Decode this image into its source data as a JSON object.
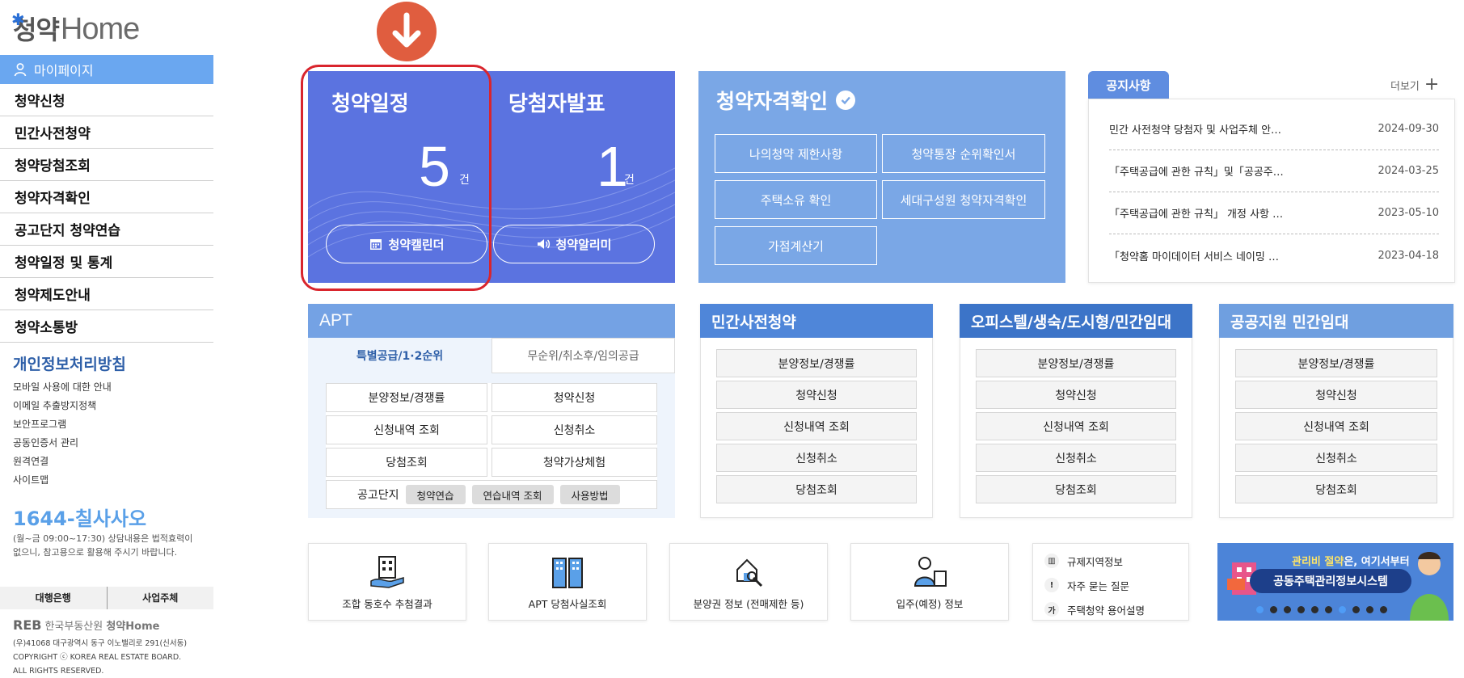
{
  "sidebar": {
    "logo_korean": "청약",
    "logo_english": "Home",
    "mypage_label": "마이페이지",
    "menu": [
      "청약신청",
      "민간사전청약",
      "청약당첨조회",
      "청약자격확인",
      "공고단지 청약연습",
      "청약일정 및 통계",
      "청약제도안내",
      "청약소통방"
    ],
    "policy_label": "개인정보처리방침",
    "sublinks": [
      "모바일 사용에 대한 안내",
      "이메일 추출방지정책",
      "보안프로그램",
      "공동인증서 관리",
      "원격연결",
      "사이트맵"
    ],
    "phone_prefix": "1644-",
    "phone_word": "칠사사오",
    "phone_note": "(월~금 09:00~17:30) 상담내용은 법적효력이 없으니, 참고용으로 활용해 주시기 바랍니다.",
    "bank_label": "대행은행",
    "business_label": "사업주체",
    "reb_mark": "REB",
    "reb_name": "한국부동산원",
    "reb_site": "청약Home",
    "address": "(우)41068 대구광역시 동구 이노밸리로 291(신서동)",
    "copyright": "COPYRIGHT ⓒ KOREA REAL ESTATE BOARD.",
    "rights": "ALL RIGHTS RESERVED."
  },
  "schedule": {
    "title": "청약일정",
    "count": "5",
    "unit": "건",
    "button": "청약캘린더"
  },
  "winners": {
    "title": "당첨자발표",
    "count": "1",
    "unit": "건",
    "button": "청약알리미"
  },
  "qualification": {
    "title": "청약자격확인",
    "buttons": [
      "나의청약 제한사항",
      "청약통장 순위확인서",
      "주택소유 확인",
      "세대구성원 청약자격확인",
      "가점계산기"
    ]
  },
  "notice": {
    "tab": "공지사항",
    "more": "더보기",
    "items": [
      {
        "title": "민간 사전청약 당첨자 및 사업주체 안…",
        "date": "2024-09-30"
      },
      {
        "title": "「주택공급에 관한 규칙」및「공공주…",
        "date": "2024-03-25"
      },
      {
        "title": "「주택공급에 관한 규칙」 개정 사항 …",
        "date": "2023-05-10"
      },
      {
        "title": "「청약홈 마이데이터 서비스 네이밍 …",
        "date": "2023-04-18"
      }
    ]
  },
  "apt": {
    "title": "APT",
    "tab_active": "특별공급/1·2순위",
    "tab_inactive": "무순위/취소후/임의공급",
    "buttons": [
      "분양정보/경쟁률",
      "청약신청",
      "신청내역 조회",
      "신청취소",
      "당첨조회",
      "청약가상체험"
    ],
    "gong_label": "공고단지",
    "gong_chips": [
      "청약연습",
      "연습내역 조회",
      "사용방법"
    ]
  },
  "categories": [
    {
      "title": "민간사전청약",
      "buttons": [
        "분양정보/경쟁률",
        "청약신청",
        "신청내역 조회",
        "신청취소",
        "당첨조회"
      ]
    },
    {
      "title": "오피스텔/생숙/도시형/민간임대",
      "buttons": [
        "분양정보/경쟁률",
        "청약신청",
        "신청내역 조회",
        "신청취소",
        "당첨조회"
      ]
    },
    {
      "title": "공공지원 민간임대",
      "buttons": [
        "분양정보/경쟁률",
        "청약신청",
        "신청내역 조회",
        "신청취소",
        "당첨조회"
      ]
    }
  ],
  "quick_links": [
    "조합 동호수 추첨결과",
    "APT 당첨사실조회",
    "분양권 정보 (전매제한 등)",
    "입주(예정) 정보"
  ],
  "info_links": [
    {
      "icon": "building-icon",
      "glyph": "▥",
      "label": "규제지역정보"
    },
    {
      "icon": "exclamation-icon",
      "glyph": "!",
      "label": "자주 묻는 질문"
    },
    {
      "icon": "ga-icon",
      "glyph": "가",
      "label": "주택청약 용어설명"
    }
  ],
  "banner": {
    "line1_highlight": "관리비 절약",
    "line1_rest": "은, 여기서부터",
    "line2": "공동주택관리정보시스템"
  },
  "colors": {
    "schedule_bg": "#5b73e0",
    "qualification_bg": "#7aa7e6",
    "notice_tab": "#5f8de0",
    "mypage_bg": "#6aa7f0",
    "highlight_ring": "#d9252d",
    "arrow": "#e05d3f"
  }
}
